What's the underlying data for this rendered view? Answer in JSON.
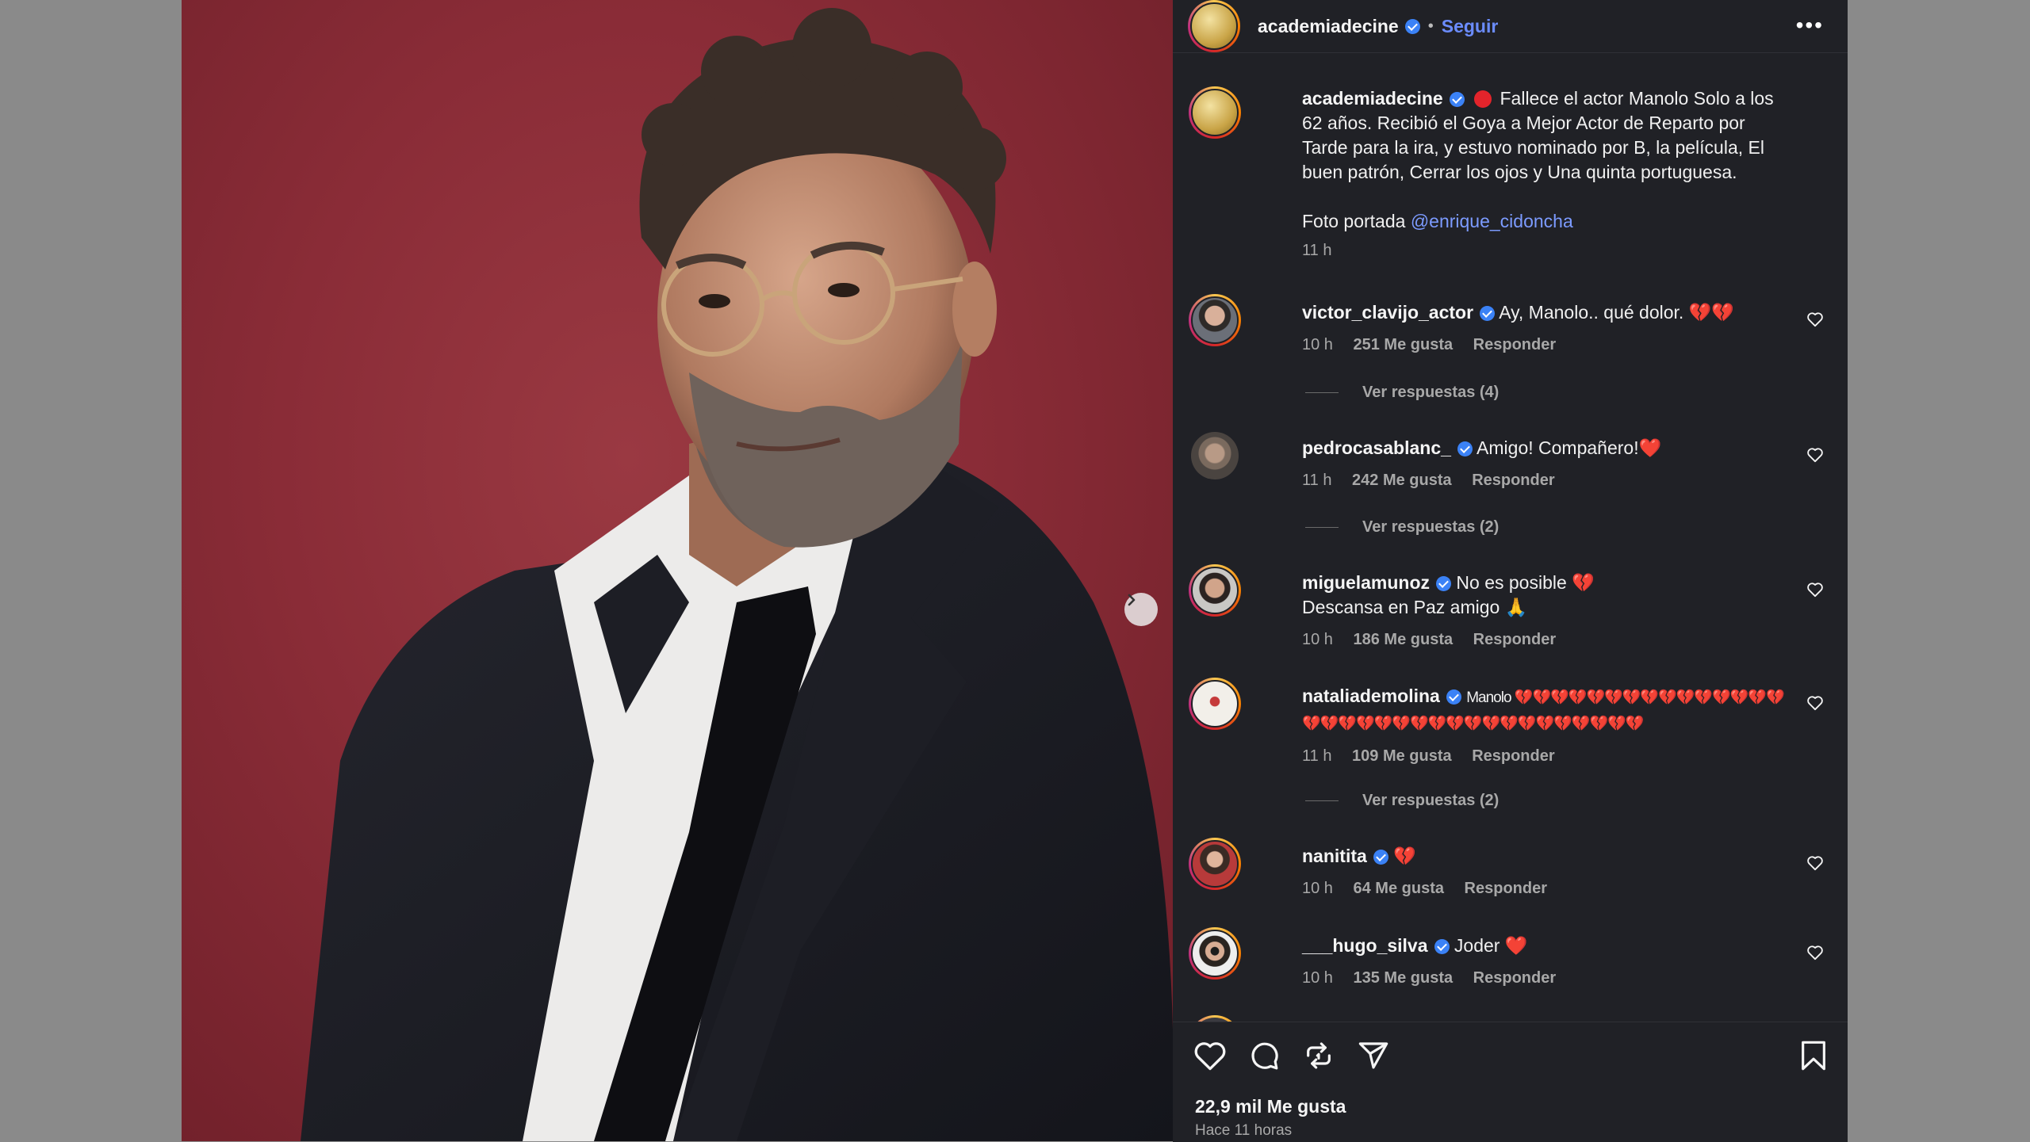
{
  "post": {
    "username": "academiadecine",
    "separator": "•",
    "follow_label": "Seguir",
    "more_label": "•••",
    "caption": {
      "username": "academiadecine",
      "text": "Fallece el actor Manolo Solo a los 62 años. Recibió el Goya a Mejor Actor de Reparto por Tarde para la ira, y estuvo nominado por B, la película, El buen patrón, Cerrar los ojos y Una quinta portuguesa.",
      "photo_credit_prefix": "Foto portada",
      "photo_credit_mention": "@enrique_cidoncha",
      "time": "11 h"
    }
  },
  "comments": [
    {
      "username": "victor_clavijo_actor",
      "text": "Ay, Manolo.. qué dolor. 💔💔",
      "time": "10 h",
      "likes": "251 Me gusta",
      "reply_label": "Responder",
      "view_replies": "Ver respuestas (4)"
    },
    {
      "username": "pedrocasablanc_",
      "text": "Amigo! Compañero!❤️",
      "time": "11 h",
      "likes": "242 Me gusta",
      "reply_label": "Responder",
      "view_replies": "Ver respuestas (2)"
    },
    {
      "username": "miguelamunoz",
      "text": "No es posible 💔",
      "text_line2": "Descansa en Paz amigo 🙏",
      "time": "10 h",
      "likes": "186 Me gusta",
      "reply_label": "Responder"
    },
    {
      "username": "nataliademolina",
      "text": "Manolo 💔💔💔💔💔💔💔💔💔💔💔💔💔💔💔💔💔💔💔💔💔💔💔💔💔💔💔💔💔💔💔💔💔💔",
      "time": "11 h",
      "likes": "109 Me gusta",
      "reply_label": "Responder",
      "view_replies": "Ver respuestas (2)"
    },
    {
      "username": "nanitita",
      "text": "💔",
      "time": "10 h",
      "likes": "64 Me gusta",
      "reply_label": "Responder"
    },
    {
      "username": "___hugo_silva",
      "text": "Joder ❤️",
      "time": "10 h",
      "likes": "135 Me gusta",
      "reply_label": "Responder"
    }
  ],
  "footer": {
    "likes": "22,9 mil Me gusta",
    "time_ago": "Hace 11 horas"
  },
  "icons": {
    "like": "heart-icon",
    "comment": "comment-icon",
    "repost": "repost-icon",
    "share": "share-icon",
    "save": "bookmark-icon",
    "next": "chevron-right-icon"
  },
  "colors": {
    "panel_bg": "#202126",
    "photo_bg": "#8a2c37",
    "link": "#6b8cff",
    "verified": "#3b82f6"
  }
}
